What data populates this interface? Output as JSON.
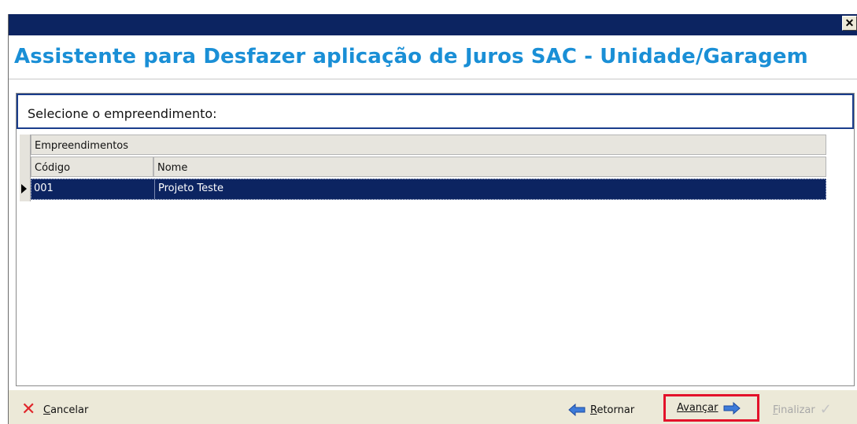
{
  "window": {
    "title": "",
    "close_glyph": "✕"
  },
  "header": {
    "title": "Assistente para Desfazer aplicação de Juros SAC - Unidade/Garagem"
  },
  "prompt": {
    "label": "Selecione o empreendimento:"
  },
  "grid": {
    "group_header": "Empreendimentos",
    "columns": [
      "Código",
      "Nome"
    ],
    "rows": [
      {
        "codigo": "001",
        "nome": "Projeto Teste",
        "selected": true
      }
    ]
  },
  "footer": {
    "cancel": {
      "label_underline": "C",
      "label_rest": "ancelar",
      "icon": "close-x-icon"
    },
    "retornar": {
      "label_underline": "R",
      "label_rest": "etornar",
      "icon": "arrow-left-icon"
    },
    "avancar": {
      "label_underline": "A",
      "label_rest": "vançar",
      "icon": "arrow-right-icon",
      "highlighted": true
    },
    "finalizar": {
      "label_underline": "F",
      "label_rest": "inalizar",
      "icon": "check-icon",
      "disabled": true
    }
  },
  "colors": {
    "title_bar": "#0c2461",
    "header_text": "#1a8fd6",
    "selected_row": "#0c2461",
    "highlight_border": "#e3122a"
  }
}
